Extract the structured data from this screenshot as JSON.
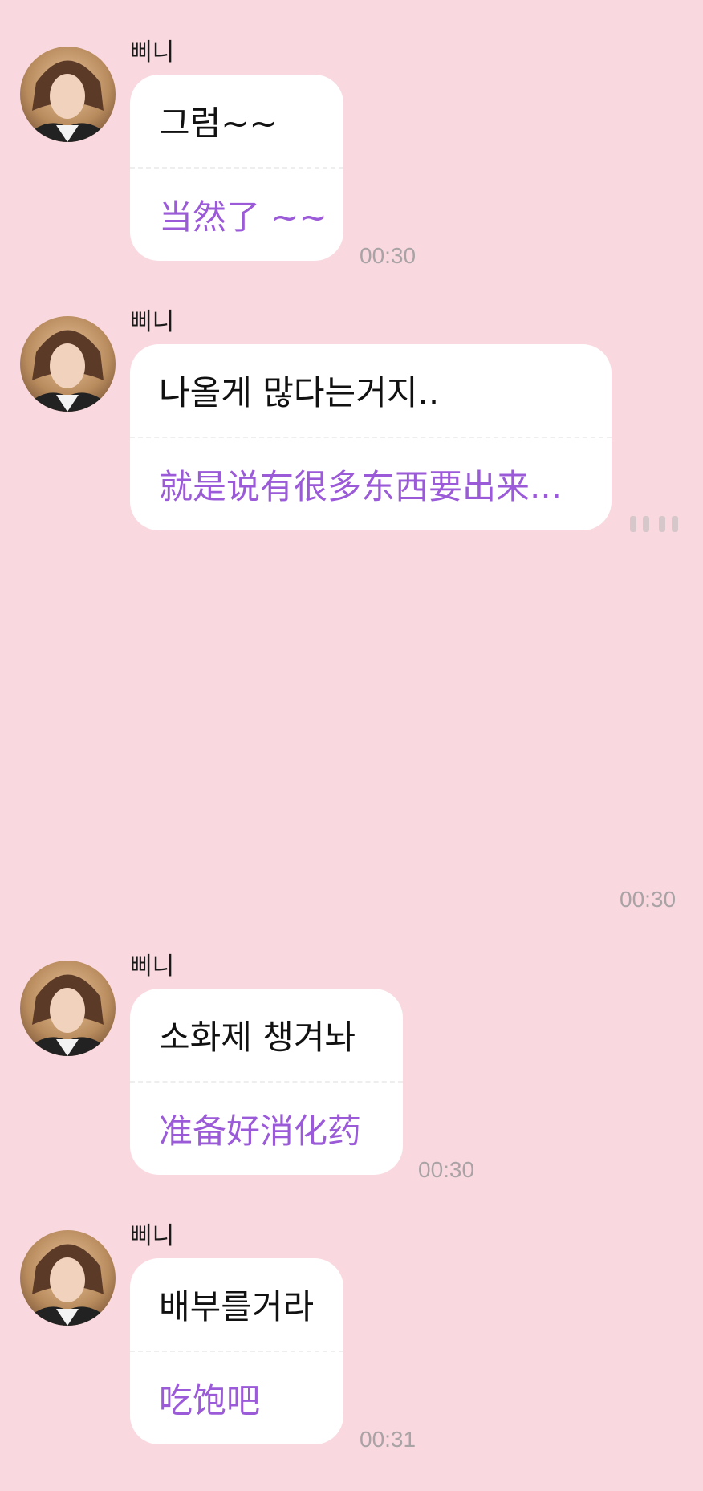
{
  "messages": [
    {
      "sender": "삐니",
      "ko": "그럼~~",
      "zh": "当然了 ~~",
      "time": "00:30"
    },
    {
      "sender": "삐니",
      "ko": "나올게 많다는거지..",
      "zh": "就是说有很多东西要出来...",
      "time": "00:30"
    },
    {
      "sender": "삐니",
      "ko": "소화제 챙겨놔",
      "zh": "准备好消化药",
      "time": "00:30"
    },
    {
      "sender": "삐니",
      "ko": "배부를거라",
      "zh": "吃饱吧",
      "time": "00:31"
    }
  ],
  "colors": {
    "background": "#f9d9df",
    "bubble": "#ffffff",
    "translation_text": "#9b5ad8",
    "timestamp": "#a9a3a6"
  }
}
